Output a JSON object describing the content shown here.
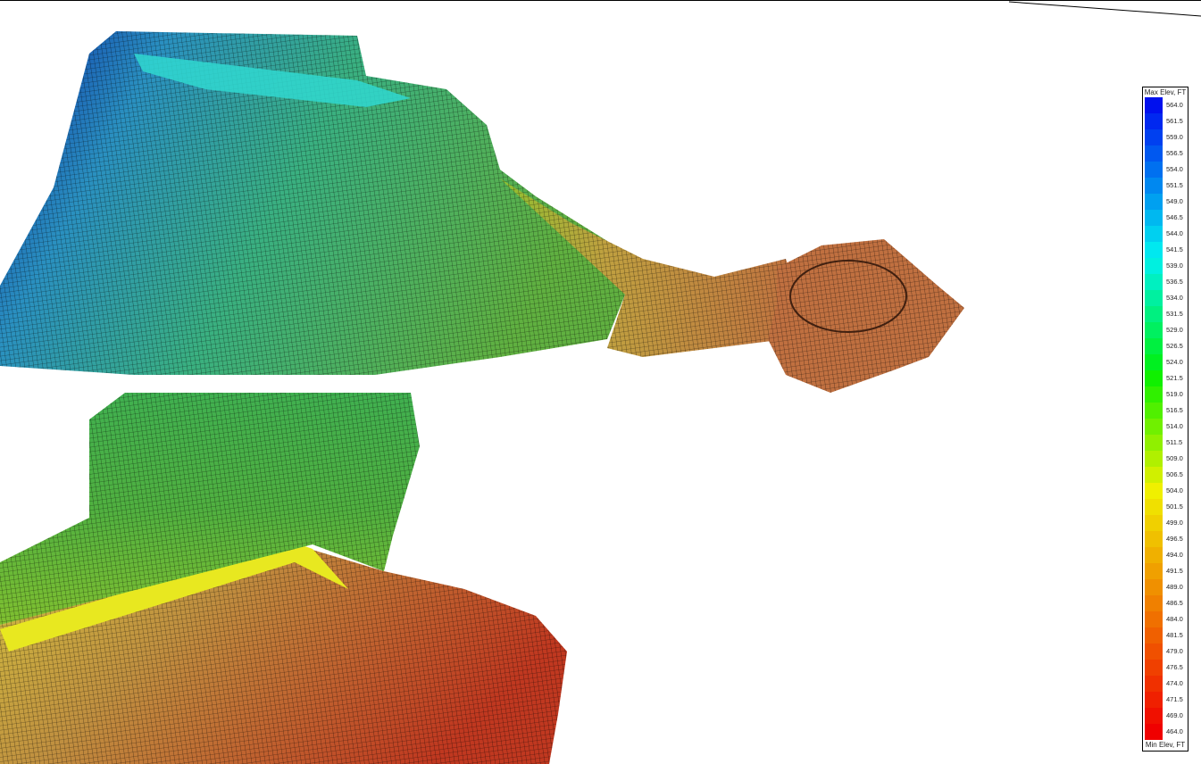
{
  "legend": {
    "max_title": "Max Elev, FT",
    "min_title": "Min Elev, FT",
    "values": [
      "564.0",
      "561.5",
      "559.0",
      "556.5",
      "554.0",
      "551.5",
      "549.0",
      "546.5",
      "544.0",
      "541.5",
      "539.0",
      "536.5",
      "534.0",
      "531.5",
      "529.0",
      "526.5",
      "524.0",
      "521.5",
      "519.0",
      "516.5",
      "514.0",
      "511.5",
      "509.0",
      "506.5",
      "504.0",
      "501.5",
      "499.0",
      "496.5",
      "494.0",
      "491.5",
      "489.0",
      "486.5",
      "484.0",
      "481.5",
      "479.0",
      "476.5",
      "474.0",
      "471.5",
      "469.0",
      "464.0"
    ],
    "colors": [
      "#0010ee",
      "#0028f0",
      "#0040f0",
      "#0058f0",
      "#0070f0",
      "#0088f0",
      "#00a0f0",
      "#00b8f0",
      "#00d0f0",
      "#00e8f0",
      "#00f0e0",
      "#00f0c0",
      "#00f0a0",
      "#00f080",
      "#00f060",
      "#00f040",
      "#00f020",
      "#10f000",
      "#30f000",
      "#50f000",
      "#70f000",
      "#90f000",
      "#b0f000",
      "#d0f000",
      "#f0f000",
      "#f0e000",
      "#f0d000",
      "#f0c000",
      "#f0b000",
      "#f0a000",
      "#f09000",
      "#f08000",
      "#f07000",
      "#f06000",
      "#f05000",
      "#f04000",
      "#f03000",
      "#f02000",
      "#f01000",
      "#f00000"
    ]
  },
  "colors": {
    "high": "#1030c8",
    "upper": "#30b0c0",
    "mid": "#40b040",
    "low_mid": "#90c030",
    "yellow": "#e8e820",
    "low": "#c08040",
    "lowest": "#c03020"
  }
}
